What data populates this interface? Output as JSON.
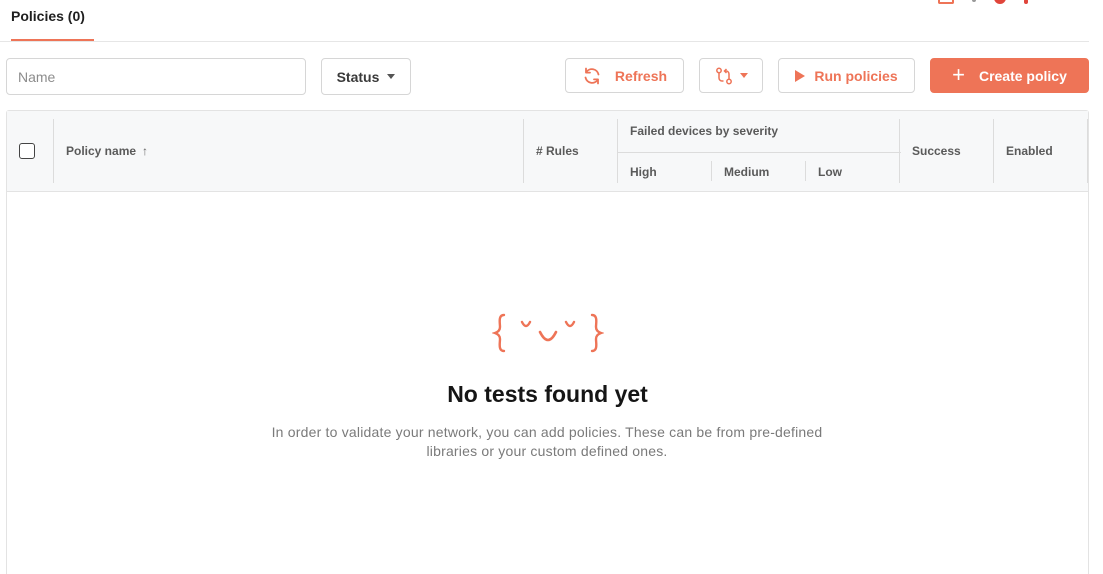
{
  "tabs": {
    "policies_label": "Policies (0)"
  },
  "toolbar": {
    "name_placeholder": "Name",
    "status_label": "Status",
    "refresh_label": "Refresh",
    "run_label": "Run policies",
    "create_label": "Create policy",
    "create_symbol": "+"
  },
  "table": {
    "headers": {
      "policy_name": "Policy name",
      "sort_indicator": "↑",
      "rules": "# Rules",
      "failed_group": "Failed devices by severity",
      "high": "High",
      "medium": "Medium",
      "low": "Low",
      "success": "Success",
      "enabled": "Enabled"
    }
  },
  "empty_state": {
    "title": "No tests found yet",
    "description": "In order to validate your network, you can add policies. These can be from pre-defined libraries or your custom defined ones."
  },
  "colors": {
    "accent": "#ee7457",
    "border": "#d6d6d6",
    "header_bg": "#f7f8f9"
  },
  "icons": [
    "refresh-icon",
    "compare-icon",
    "play-icon",
    "plus-icon",
    "sort-up-icon",
    "empty-face-icon"
  ]
}
